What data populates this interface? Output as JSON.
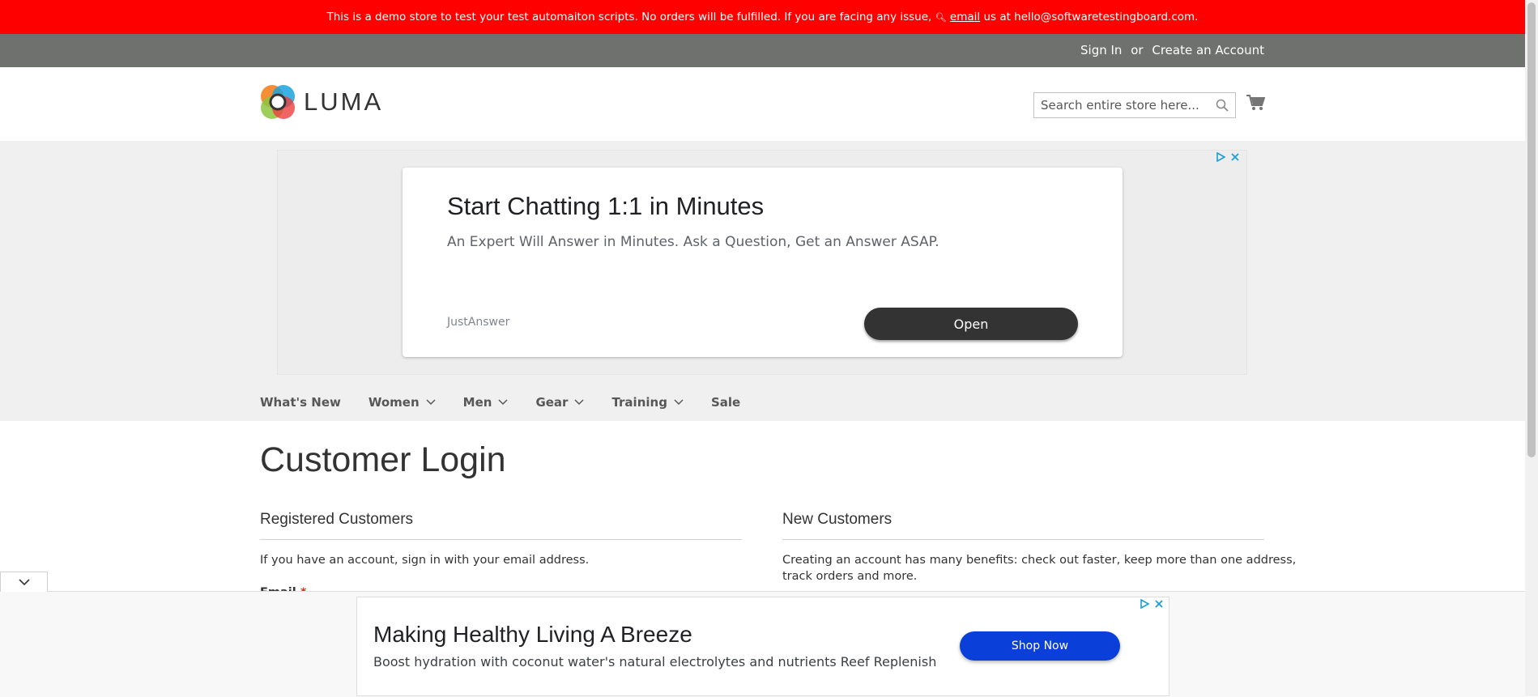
{
  "demo_notice": {
    "text_before": "This is a demo store to test your test automaiton scripts. No orders will be fulfilled. If you are facing any issue,",
    "email_link": "email",
    "text_after": "us at hello@softwaretestingboard.com."
  },
  "header_panel": {
    "sign_in": "Sign In",
    "or": "or",
    "create_account": "Create an Account"
  },
  "logo": {
    "text": "LUMA"
  },
  "search": {
    "placeholder": "Search entire store here...",
    "icon": "search-icon"
  },
  "cart": {
    "icon": "cart-icon"
  },
  "ad_top": {
    "title": "Start Chatting 1:1 in Minutes",
    "subtitle": "An Expert Will Answer in Minutes. Ask a Question, Get an Answer ASAP.",
    "brand": "JustAnswer",
    "button": "Open"
  },
  "nav": {
    "items": [
      {
        "label": "What's New",
        "has_dropdown": false
      },
      {
        "label": "Women",
        "has_dropdown": true
      },
      {
        "label": "Men",
        "has_dropdown": true
      },
      {
        "label": "Gear",
        "has_dropdown": true
      },
      {
        "label": "Training",
        "has_dropdown": true
      },
      {
        "label": "Sale",
        "has_dropdown": false
      }
    ]
  },
  "page": {
    "title": "Customer Login",
    "registered": {
      "title": "Registered Customers",
      "text": "If you have an account, sign in with your email address.",
      "email_label": "Email",
      "required_mark": "*"
    },
    "new_customers": {
      "title": "New Customers",
      "text_line1": "Creating an account has many benefits: check out faster, keep more than one address,",
      "text_line2": "track orders and more."
    }
  },
  "ad_bottom": {
    "title": "Making Healthy Living A Breeze",
    "subtitle": "Boost hydration with coconut water's natural electrolytes and nutrients Reef Replenish",
    "button": "Shop Now"
  },
  "colors": {
    "demo_bar": "#ff0000",
    "panel_bar": "#6e716e",
    "band": "#f0f0f0",
    "ad_button_dark": "#333333",
    "ad_button_blue": "#0b3fd9",
    "required": "#e02b27"
  }
}
